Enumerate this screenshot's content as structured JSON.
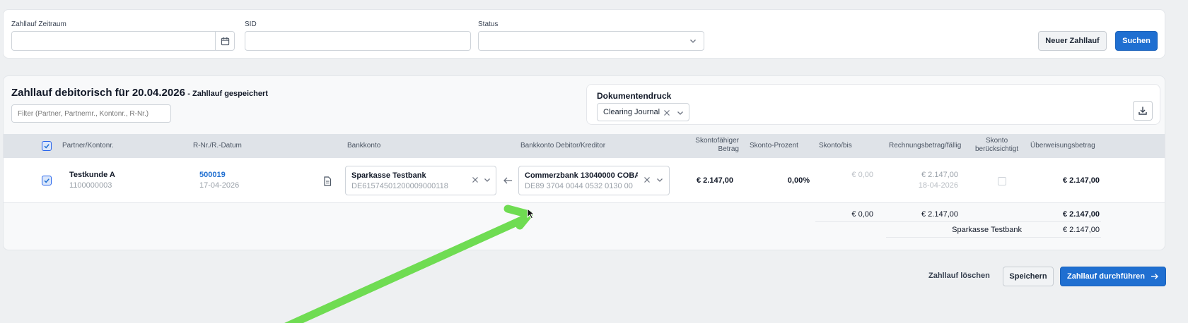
{
  "filters": {
    "zeitraum_label": "Zahllauf Zeitraum",
    "zeitraum_value": "",
    "sid_label": "SID",
    "sid_value": "",
    "status_label": "Status",
    "status_value": "",
    "new_button": "Neuer Zahllauf",
    "search_button": "Suchen"
  },
  "run": {
    "title": "Zahllauf debitorisch für 20.04.2026",
    "subtitle": "- Zahllauf gespeichert",
    "filter_placeholder": "Filter (Partner, Partnernr., Kontonr., R-Nr.)"
  },
  "document_print": {
    "title": "Dokumentendruck",
    "selected": "Clearing Journal"
  },
  "table": {
    "headers": {
      "partner": "Partner/Kontonr.",
      "invoice": "R-Nr./R.-Datum",
      "bank": "Bankkonto",
      "bank_partner": "Bankkonto Debitor/Kreditor",
      "skontofaehig_1": "Skontofähiger",
      "skontofaehig_2": "Betrag",
      "skonto_prozent": "Skonto-Prozent",
      "skonto_bis": "Skonto/bis",
      "rechnungsbetrag": "Rechnungsbetrag/fällig",
      "skonto_beruecksichtigt_1": "Skonto",
      "skonto_beruecksichtigt_2": "berücksichtigt",
      "ueberweisung": "Überweisungsbetrag"
    },
    "row": {
      "partner_name": "Testkunde A",
      "account_no": "1100000003",
      "invoice_no": "500019",
      "invoice_date": "17-04-2026",
      "bank_name": "Sparkasse Testbank",
      "bank_iban": "DE61574501200009000118",
      "partner_bank_name": "Commerzbank 13040000 COBA",
      "partner_bank_iban": "DE89 3704 0044 0532 0130 00",
      "skontofaehig": "€ 2.147,00",
      "skonto_prozent": "0,00%",
      "skonto": "€ 0,00",
      "rechnungsbetrag": "€ 2.147,00",
      "faellig": "18-04-2026",
      "ueberweisung": "€ 2.147,00"
    },
    "totals": {
      "skonto": "€ 0,00",
      "rechnungsbetrag": "€ 2.147,00",
      "ueberweisung": "€ 2.147,00",
      "bank_label": "Sparkasse Testbank",
      "bank_amount": "€ 2.147,00"
    }
  },
  "actions": {
    "delete": "Zahllauf löschen",
    "save": "Speichern",
    "execute": "Zahllauf durchführen"
  },
  "colors": {
    "accent": "#1f6fd1",
    "annotation_arrow": "#6fdc52"
  }
}
